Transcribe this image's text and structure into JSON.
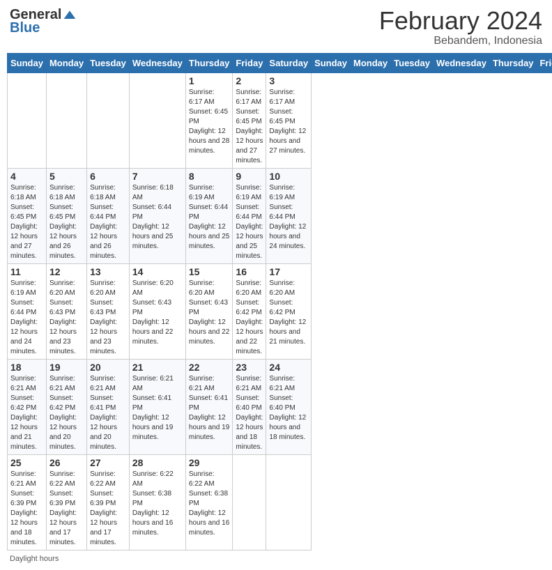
{
  "header": {
    "logo_general": "General",
    "logo_blue": "Blue",
    "month_title": "February 2024",
    "subtitle": "Bebandem, Indonesia"
  },
  "days_of_week": [
    "Sunday",
    "Monday",
    "Tuesday",
    "Wednesday",
    "Thursday",
    "Friday",
    "Saturday"
  ],
  "weeks": [
    [
      {
        "day": "",
        "info": ""
      },
      {
        "day": "",
        "info": ""
      },
      {
        "day": "",
        "info": ""
      },
      {
        "day": "",
        "info": ""
      },
      {
        "day": "1",
        "info": "Sunrise: 6:17 AM\nSunset: 6:45 PM\nDaylight: 12 hours and 28 minutes."
      },
      {
        "day": "2",
        "info": "Sunrise: 6:17 AM\nSunset: 6:45 PM\nDaylight: 12 hours and 27 minutes."
      },
      {
        "day": "3",
        "info": "Sunrise: 6:17 AM\nSunset: 6:45 PM\nDaylight: 12 hours and 27 minutes."
      }
    ],
    [
      {
        "day": "4",
        "info": "Sunrise: 6:18 AM\nSunset: 6:45 PM\nDaylight: 12 hours and 27 minutes."
      },
      {
        "day": "5",
        "info": "Sunrise: 6:18 AM\nSunset: 6:45 PM\nDaylight: 12 hours and 26 minutes."
      },
      {
        "day": "6",
        "info": "Sunrise: 6:18 AM\nSunset: 6:44 PM\nDaylight: 12 hours and 26 minutes."
      },
      {
        "day": "7",
        "info": "Sunrise: 6:18 AM\nSunset: 6:44 PM\nDaylight: 12 hours and 25 minutes."
      },
      {
        "day": "8",
        "info": "Sunrise: 6:19 AM\nSunset: 6:44 PM\nDaylight: 12 hours and 25 minutes."
      },
      {
        "day": "9",
        "info": "Sunrise: 6:19 AM\nSunset: 6:44 PM\nDaylight: 12 hours and 25 minutes."
      },
      {
        "day": "10",
        "info": "Sunrise: 6:19 AM\nSunset: 6:44 PM\nDaylight: 12 hours and 24 minutes."
      }
    ],
    [
      {
        "day": "11",
        "info": "Sunrise: 6:19 AM\nSunset: 6:44 PM\nDaylight: 12 hours and 24 minutes."
      },
      {
        "day": "12",
        "info": "Sunrise: 6:20 AM\nSunset: 6:43 PM\nDaylight: 12 hours and 23 minutes."
      },
      {
        "day": "13",
        "info": "Sunrise: 6:20 AM\nSunset: 6:43 PM\nDaylight: 12 hours and 23 minutes."
      },
      {
        "day": "14",
        "info": "Sunrise: 6:20 AM\nSunset: 6:43 PM\nDaylight: 12 hours and 22 minutes."
      },
      {
        "day": "15",
        "info": "Sunrise: 6:20 AM\nSunset: 6:43 PM\nDaylight: 12 hours and 22 minutes."
      },
      {
        "day": "16",
        "info": "Sunrise: 6:20 AM\nSunset: 6:42 PM\nDaylight: 12 hours and 22 minutes."
      },
      {
        "day": "17",
        "info": "Sunrise: 6:20 AM\nSunset: 6:42 PM\nDaylight: 12 hours and 21 minutes."
      }
    ],
    [
      {
        "day": "18",
        "info": "Sunrise: 6:21 AM\nSunset: 6:42 PM\nDaylight: 12 hours and 21 minutes."
      },
      {
        "day": "19",
        "info": "Sunrise: 6:21 AM\nSunset: 6:42 PM\nDaylight: 12 hours and 20 minutes."
      },
      {
        "day": "20",
        "info": "Sunrise: 6:21 AM\nSunset: 6:41 PM\nDaylight: 12 hours and 20 minutes."
      },
      {
        "day": "21",
        "info": "Sunrise: 6:21 AM\nSunset: 6:41 PM\nDaylight: 12 hours and 19 minutes."
      },
      {
        "day": "22",
        "info": "Sunrise: 6:21 AM\nSunset: 6:41 PM\nDaylight: 12 hours and 19 minutes."
      },
      {
        "day": "23",
        "info": "Sunrise: 6:21 AM\nSunset: 6:40 PM\nDaylight: 12 hours and 18 minutes."
      },
      {
        "day": "24",
        "info": "Sunrise: 6:21 AM\nSunset: 6:40 PM\nDaylight: 12 hours and 18 minutes."
      }
    ],
    [
      {
        "day": "25",
        "info": "Sunrise: 6:21 AM\nSunset: 6:39 PM\nDaylight: 12 hours and 18 minutes."
      },
      {
        "day": "26",
        "info": "Sunrise: 6:22 AM\nSunset: 6:39 PM\nDaylight: 12 hours and 17 minutes."
      },
      {
        "day": "27",
        "info": "Sunrise: 6:22 AM\nSunset: 6:39 PM\nDaylight: 12 hours and 17 minutes."
      },
      {
        "day": "28",
        "info": "Sunrise: 6:22 AM\nSunset: 6:38 PM\nDaylight: 12 hours and 16 minutes."
      },
      {
        "day": "29",
        "info": "Sunrise: 6:22 AM\nSunset: 6:38 PM\nDaylight: 12 hours and 16 minutes."
      },
      {
        "day": "",
        "info": ""
      },
      {
        "day": "",
        "info": ""
      }
    ]
  ],
  "footer": {
    "daylight_hours": "Daylight hours"
  }
}
